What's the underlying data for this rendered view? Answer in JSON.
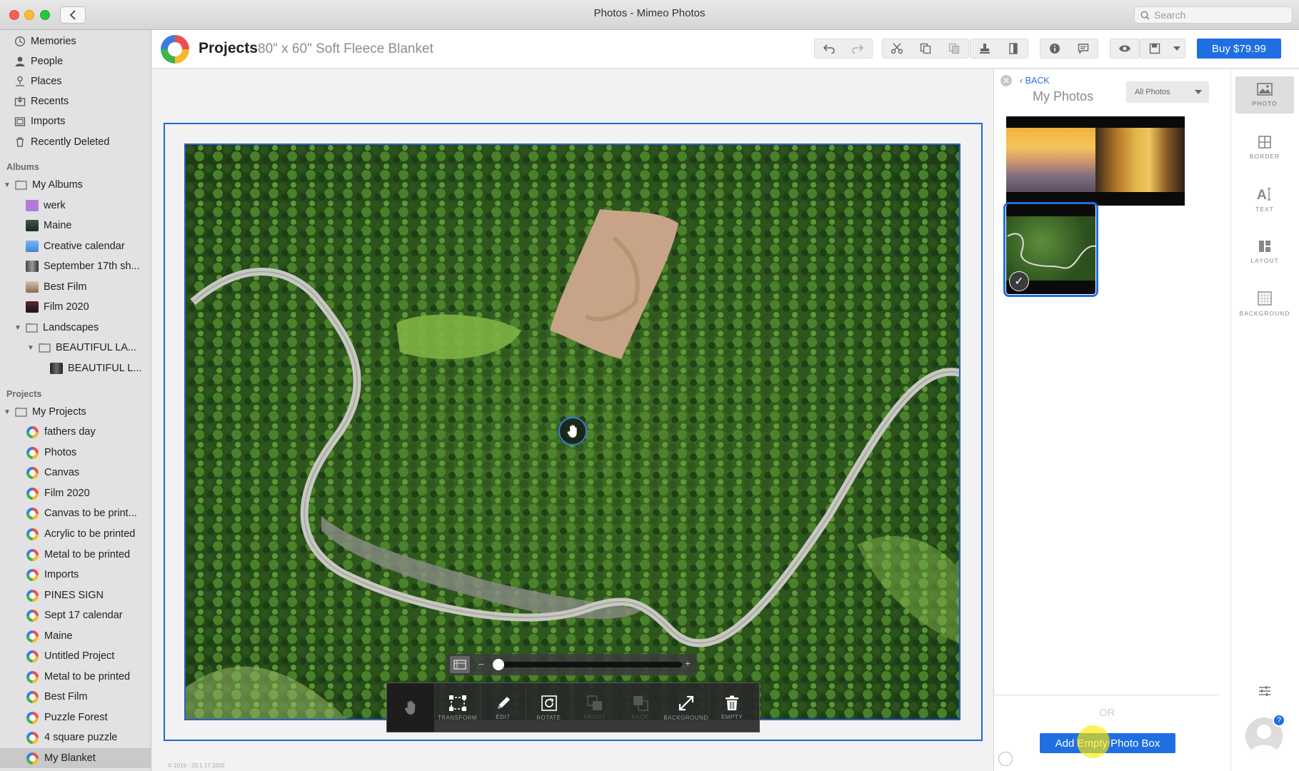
{
  "window": {
    "title": "Photos - Mimeo Photos",
    "search_placeholder": "Search"
  },
  "sidebar": {
    "library": [
      {
        "label": "Memories",
        "icon": "memories-icon"
      },
      {
        "label": "People",
        "icon": "person-icon"
      },
      {
        "label": "Places",
        "icon": "pin-icon"
      },
      {
        "label": "Recents",
        "icon": "recents-icon"
      },
      {
        "label": "Imports",
        "icon": "imports-icon"
      },
      {
        "label": "Recently Deleted",
        "icon": "trash-icon"
      }
    ],
    "albums_header": "Albums",
    "albums": [
      {
        "label": "My Albums"
      },
      {
        "label": "werk"
      },
      {
        "label": "Maine"
      },
      {
        "label": "Creative calendar"
      },
      {
        "label": "September 17th sh..."
      },
      {
        "label": "Best Film"
      },
      {
        "label": "Film 2020"
      },
      {
        "label": "Landscapes"
      },
      {
        "label": "BEAUTIFUL LA..."
      },
      {
        "label": "BEAUTIFUL L..."
      }
    ],
    "projects_header": "Projects",
    "projects": [
      {
        "label": "My Projects"
      },
      {
        "label": "fathers day"
      },
      {
        "label": "Photos"
      },
      {
        "label": "Canvas"
      },
      {
        "label": "Film 2020"
      },
      {
        "label": "Canvas to be print..."
      },
      {
        "label": "Acrylic to be printed"
      },
      {
        "label": "Metal to be printed"
      },
      {
        "label": "Imports"
      },
      {
        "label": "PINES SIGN"
      },
      {
        "label": "Sept 17 calendar"
      },
      {
        "label": "Maine"
      },
      {
        "label": "Untitled Project"
      },
      {
        "label": "Metal to be printed"
      },
      {
        "label": "Best Film"
      },
      {
        "label": "Puzzle Forest"
      },
      {
        "label": "4 square puzzle"
      },
      {
        "label": "My Blanket"
      }
    ]
  },
  "header": {
    "title": "Projects",
    "subtitle": "80\" x 60\" Soft Fleece Blanket",
    "buy_label": "Buy $79.99"
  },
  "editor": {
    "tools": [
      {
        "label": "",
        "icon": "hand-icon"
      },
      {
        "label": "TRANSFORM",
        "icon": "transform-icon"
      },
      {
        "label": "EDIT",
        "icon": "pencil-icon"
      },
      {
        "label": "ROTATE",
        "icon": "rotate-icon"
      },
      {
        "label": "FRONT",
        "icon": "bring-front-icon"
      },
      {
        "label": "BACK",
        "icon": "send-back-icon"
      },
      {
        "label": "BACKGROUND",
        "icon": "expand-icon"
      },
      {
        "label": "EMPTY",
        "icon": "trash-icon"
      }
    ],
    "zoom_minus": "–",
    "zoom_plus": "+",
    "zoom_level": 0,
    "copyright": "© 2019 - 20.1.17.1002"
  },
  "panel": {
    "back_label": "BACK",
    "title": "My Photos",
    "filter_value": "All Photos",
    "or_label": "OR",
    "add_button": "Add Empty Photo Box"
  },
  "rail": {
    "items": [
      {
        "label": "PHOTO",
        "icon": "photo-icon"
      },
      {
        "label": "BORDER",
        "icon": "grid-icon"
      },
      {
        "label": "TEXT",
        "icon": "text-icon"
      },
      {
        "label": "LAYOUT",
        "icon": "layout-icon"
      },
      {
        "label": "BACKGROUND",
        "icon": "background-icon"
      }
    ],
    "help_badge": "?"
  },
  "colors": {
    "accent": "#1f6fe3",
    "selection_frame": "#2468d9"
  }
}
